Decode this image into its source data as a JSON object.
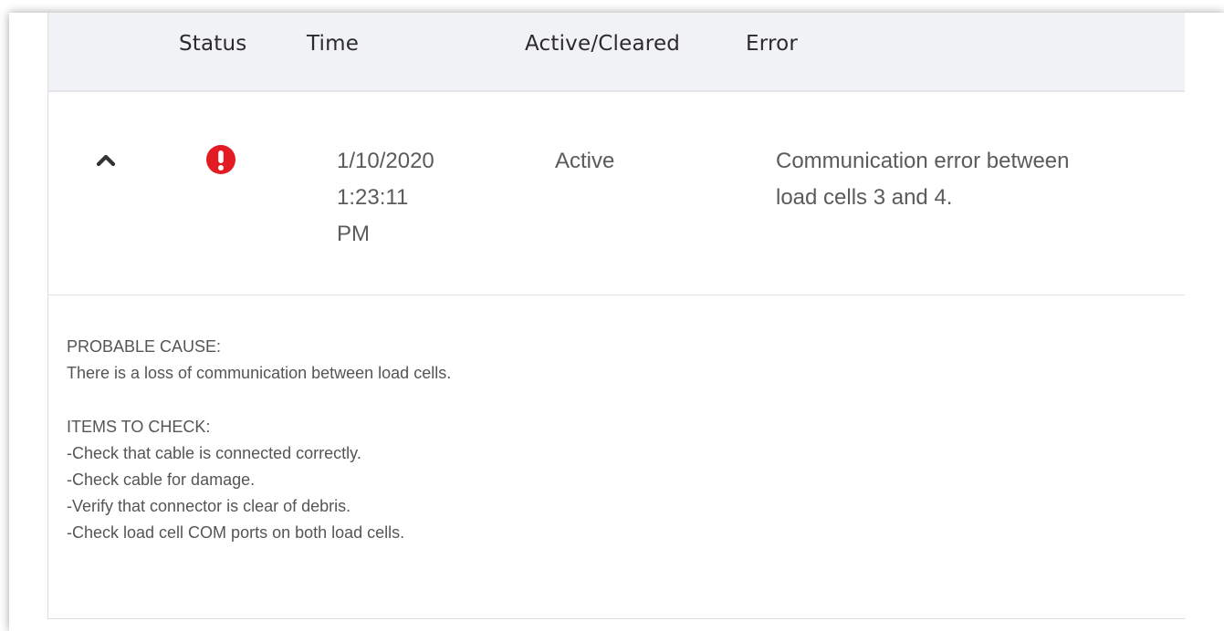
{
  "table": {
    "columns": [
      "Status",
      "Time",
      "Active/Cleared",
      "Error"
    ]
  },
  "row": {
    "expand_icon": "chevron-up-icon",
    "status_icon": "error-alert-icon",
    "status_color": "#e31b23",
    "time_line1": "1/10/2020",
    "time_line2": "1:23:11",
    "time_line3": "PM",
    "state": "Active",
    "error_line1": "Communication error between",
    "error_line2": "load cells 3 and 4."
  },
  "details": {
    "probable_cause_heading": "PROBABLE CAUSE:",
    "probable_cause_text": "There is a loss of communication between load cells.",
    "items_heading": "ITEMS TO CHECK:",
    "items": [
      "-Check that cable is connected correctly.",
      "-Check cable for damage.",
      "-Verify that connector is clear of debris.",
      "-Check load cell COM ports on both load cells."
    ]
  }
}
